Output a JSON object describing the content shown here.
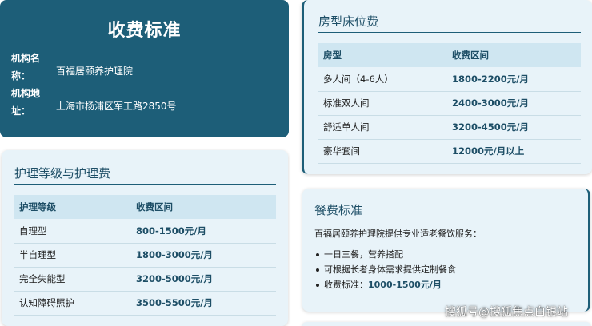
{
  "header": {
    "title": "收费标准",
    "org_label": "机构名称：",
    "org_value": "百福居颐养护理院",
    "addr_label": "机构地址：",
    "addr_value": "上海市杨浦区军工路2850号"
  },
  "room_fees": {
    "title": "房型床位费",
    "columns": [
      "房型",
      "收费区间"
    ],
    "rows": [
      [
        "多人间（4-6人）",
        "1800-2200元/月"
      ],
      [
        "标准双人间",
        "2400-3000元/月"
      ],
      [
        "舒适单人间",
        "3200-4500元/月"
      ],
      [
        "豪华套间",
        "12000元/月以上"
      ]
    ]
  },
  "care_fees": {
    "title": "护理等级与护理费",
    "columns": [
      "护理等级",
      "收费区间"
    ],
    "rows": [
      [
        "自理型",
        "800-1500元/月"
      ],
      [
        "半自理型",
        "1800-3000元/月"
      ],
      [
        "完全失能型",
        "3200-5000元/月"
      ],
      [
        "认知障碍照护",
        "3500-5500元/月"
      ]
    ]
  },
  "meal": {
    "title": "餐费标准",
    "intro": "百福居颐养护理院提供专业适老餐饮服务：",
    "items": [
      "一日三餐，营养搭配",
      "可根据长者身体需求提供定制餐食"
    ],
    "fee_label": "收费标准：",
    "fee_value": "1000-1500元/月"
  },
  "watermark": "搜狐号@搜狐焦点白银站",
  "colors": {
    "primary": "#1d5e78",
    "card_bg": "#e8f3f9",
    "header_bg": "#cfe6f1"
  }
}
